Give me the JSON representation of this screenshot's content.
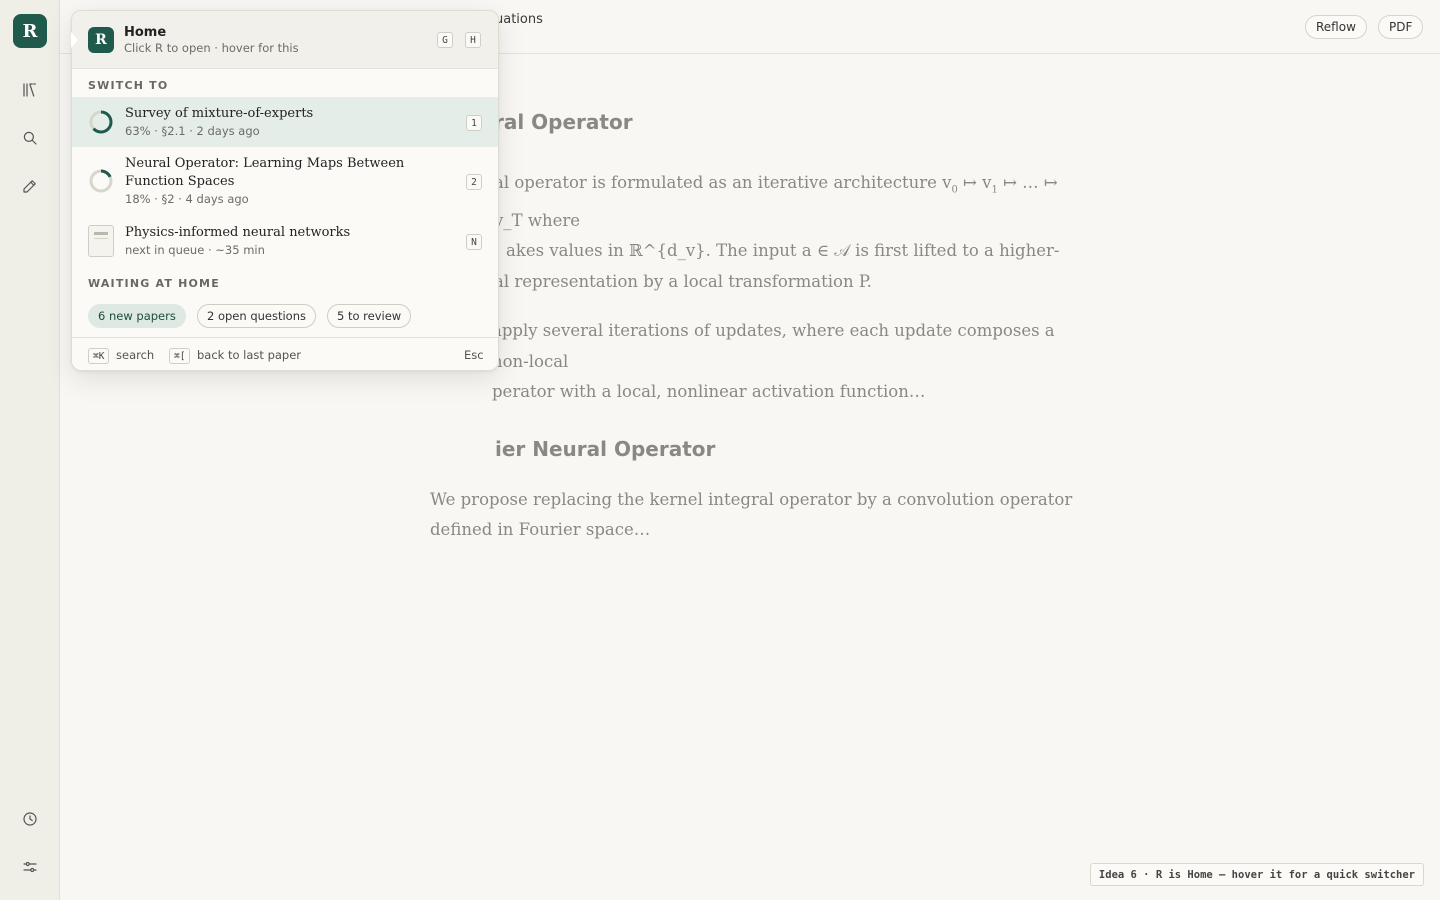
{
  "rail": {
    "logo": "R",
    "icons": [
      "library-icon",
      "search-icon",
      "pencil-icon",
      "history-icon",
      "settings-sliders-icon"
    ]
  },
  "topbar": {
    "title_fragment": "uations",
    "reflow_label": "Reflow",
    "pdf_label": "PDF"
  },
  "document": {
    "heading1": "ral Operator",
    "para1_a": "al operator is formulated as an iterative architecture v",
    "para1_sub0": "0",
    "para1_b": " ↦ v",
    "para1_sub1": "1",
    "para1_c": " ↦ … ↦ v_T where",
    "para1_line2": "akes values in ℝ^{d_v}. The input a ∈ 𝒜 is first lifted to a higher-",
    "para1_line3": "al representation by a local transformation P.",
    "para2_line1": "apply several iterations of updates, where each update composes a non-local",
    "para2_line2": "perator with a local, nonlinear activation function…",
    "heading2": "ier Neural Operator",
    "para3": "We propose replacing the kernel integral operator by a convolution operator defined in Fourier space…"
  },
  "switcher": {
    "header": {
      "logo": "R",
      "title": "Home",
      "subtitle": "Click R to open · hover for this",
      "keys": [
        "G",
        "H"
      ]
    },
    "switch_label": "SWITCH TO",
    "items": [
      {
        "title": "Survey of mixture-of-experts",
        "meta": "63% · §2.1 · 2 days ago",
        "key": "1",
        "progress": 0.63
      },
      {
        "title": "Neural Operator: Learning Maps Between Function Spaces",
        "meta": "18% · §2 · 4 days ago",
        "key": "2",
        "progress": 0.18
      },
      {
        "title": "Physics-informed neural networks",
        "meta": "next in queue · ~35 min",
        "key": "N"
      }
    ],
    "waiting_label": "WAITING AT HOME",
    "chips": [
      "6 new papers",
      "2 open questions",
      "5 to review"
    ],
    "footer": {
      "search_key": "⌘K",
      "search_label": "search",
      "back_key": "⌘[",
      "back_label": "back to last paper",
      "esc_label": "Esc"
    }
  },
  "tip": "Idea 6 · R is Home — hover it for a quick switcher",
  "colors": {
    "brand": "#1f5a4c",
    "active_row": "#e4ede7",
    "background": "#f8f7f3"
  }
}
